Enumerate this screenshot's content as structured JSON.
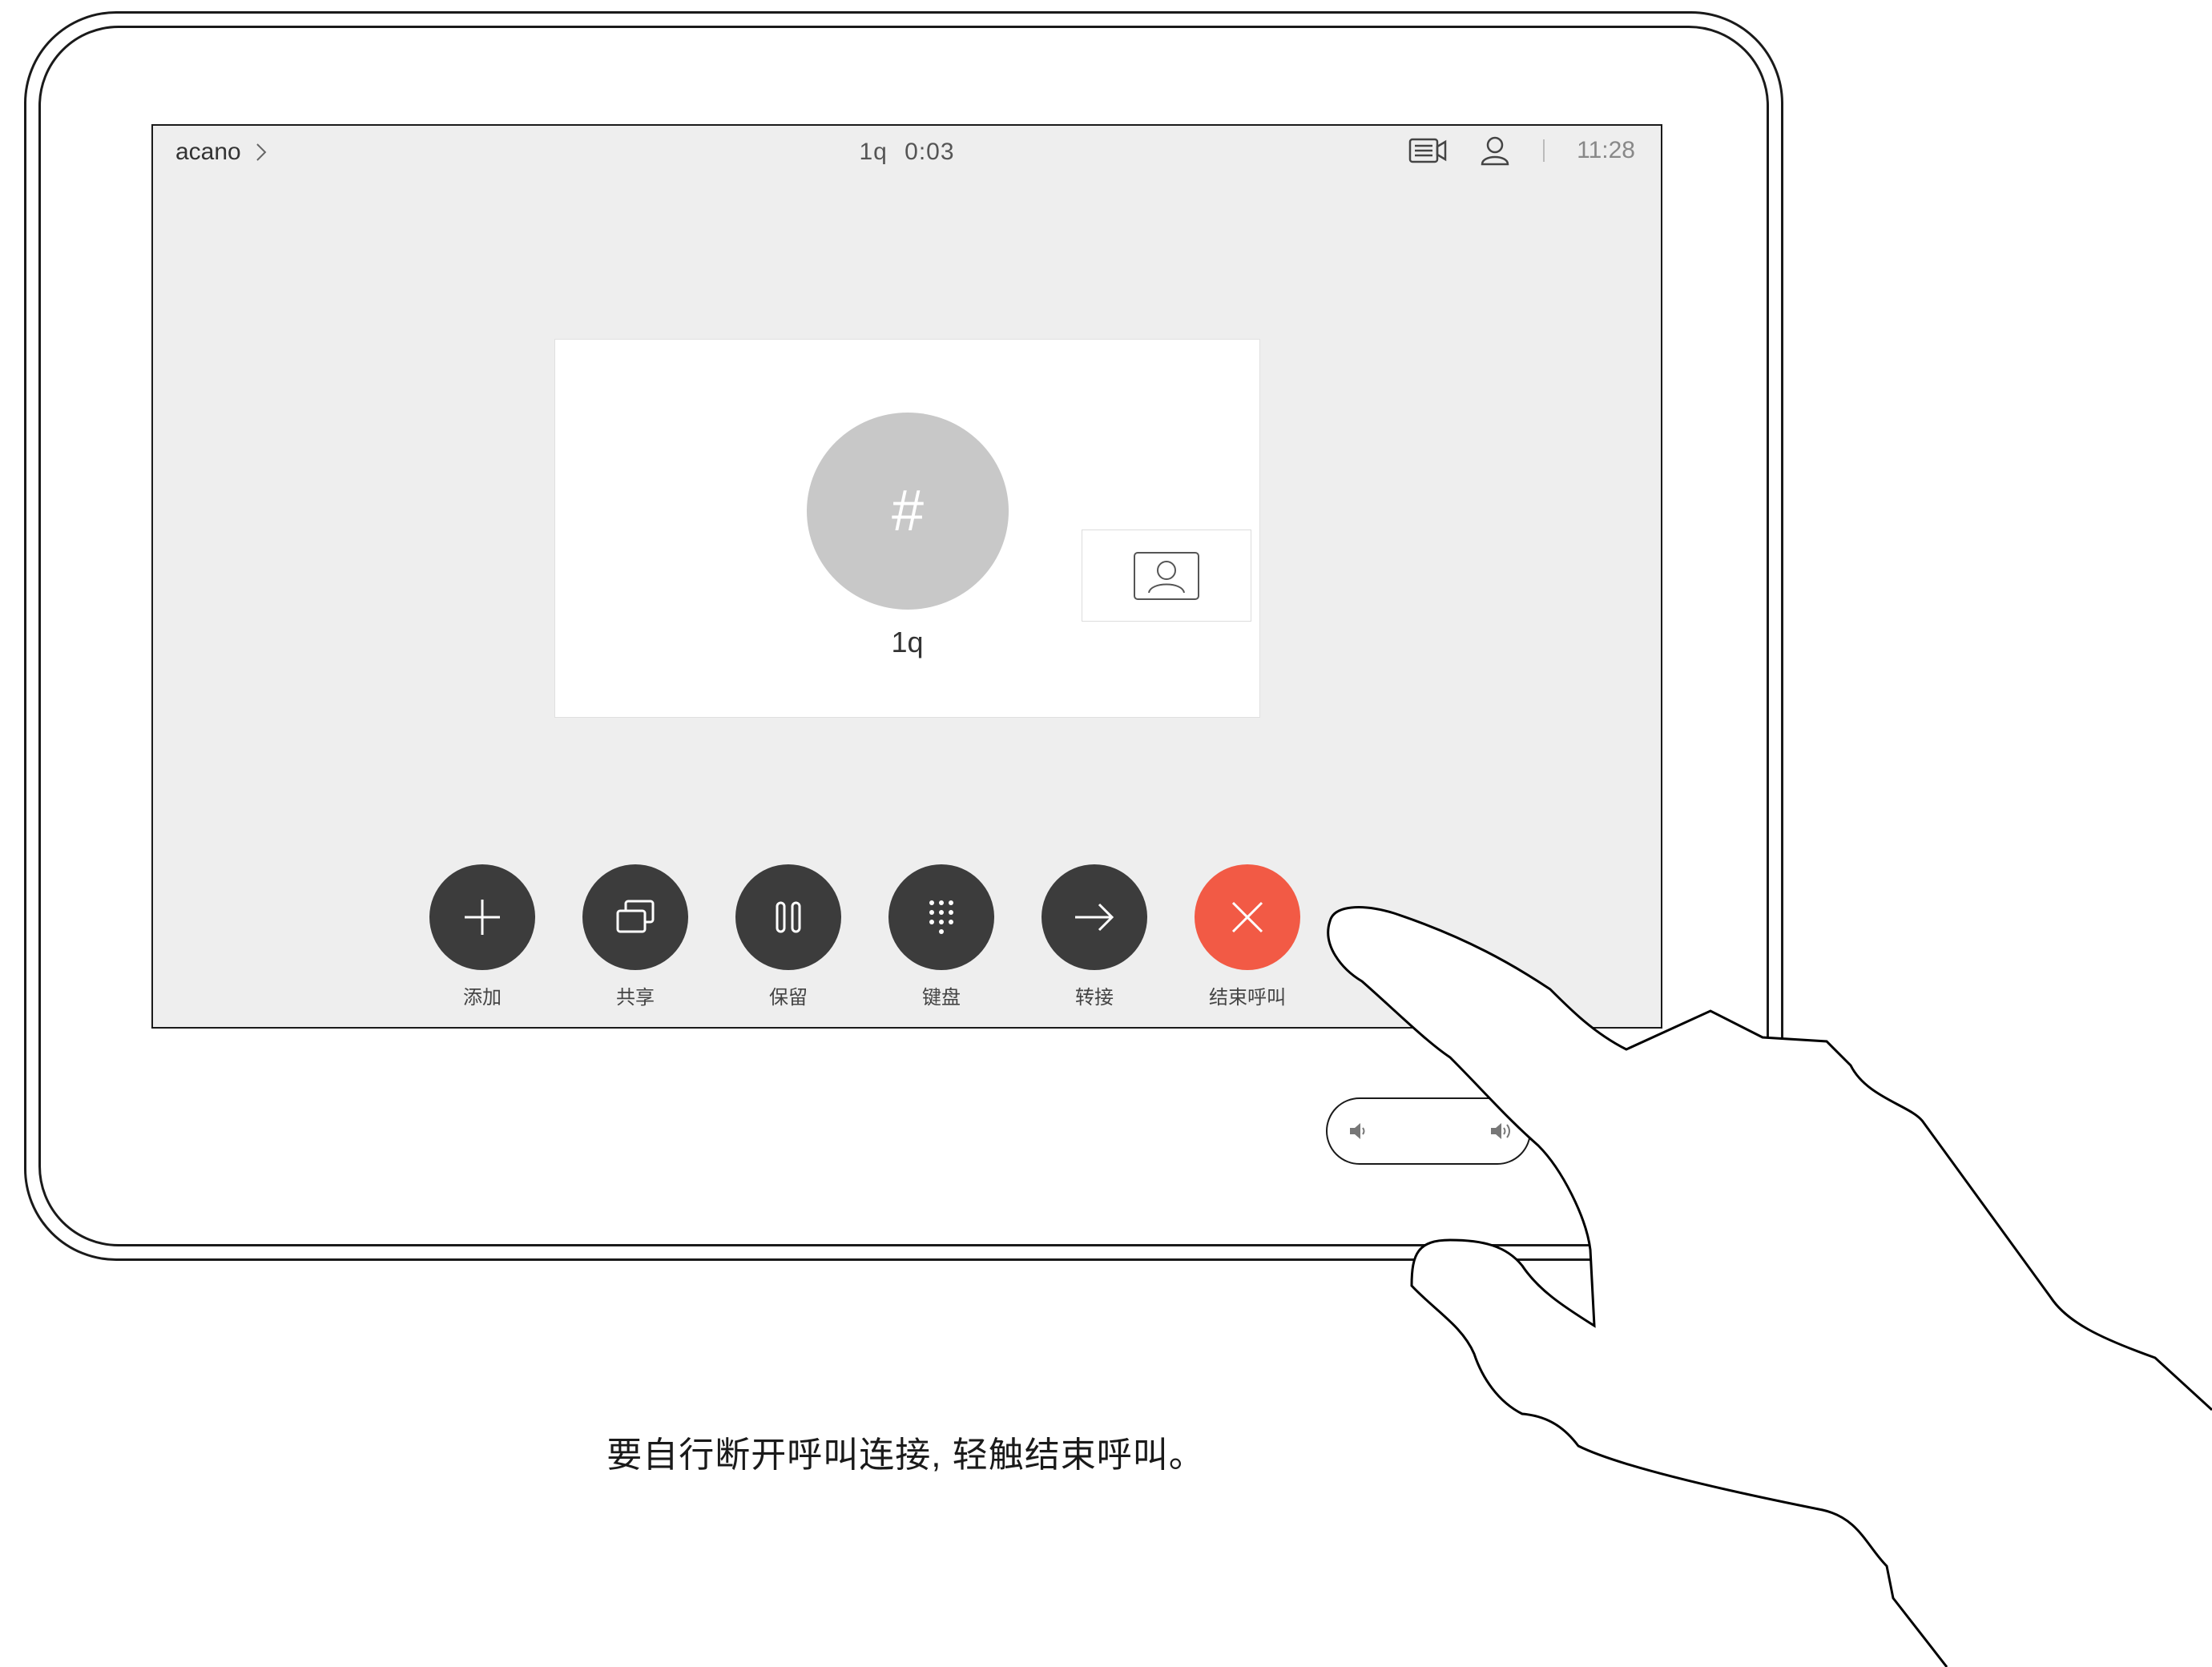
{
  "status_bar": {
    "breadcrumb": "acano",
    "call_name": "1q",
    "call_duration": "0:03",
    "clock": "11:28",
    "icons": [
      "camera-list-icon",
      "person-icon",
      "chevron-right-icon"
    ]
  },
  "call": {
    "avatar_symbol": "#",
    "contact_name": "1q"
  },
  "controls": [
    {
      "label": "添加",
      "icon": "plus-icon"
    },
    {
      "label": "共享",
      "icon": "share-icon"
    },
    {
      "label": "保留",
      "icon": "pause-icon"
    },
    {
      "label": "键盘",
      "icon": "keypad-icon"
    },
    {
      "label": "转接",
      "icon": "arrow-right-icon"
    },
    {
      "label": "结束呼叫",
      "icon": "close-icon",
      "color": "#f25a45"
    }
  ],
  "colors": {
    "end_call": "#f25a45",
    "control_button": "#3c3c3c",
    "screen_bg": "#eeeeee"
  },
  "caption": "要自行断开呼叫连接, 轻触结束呼叫。"
}
